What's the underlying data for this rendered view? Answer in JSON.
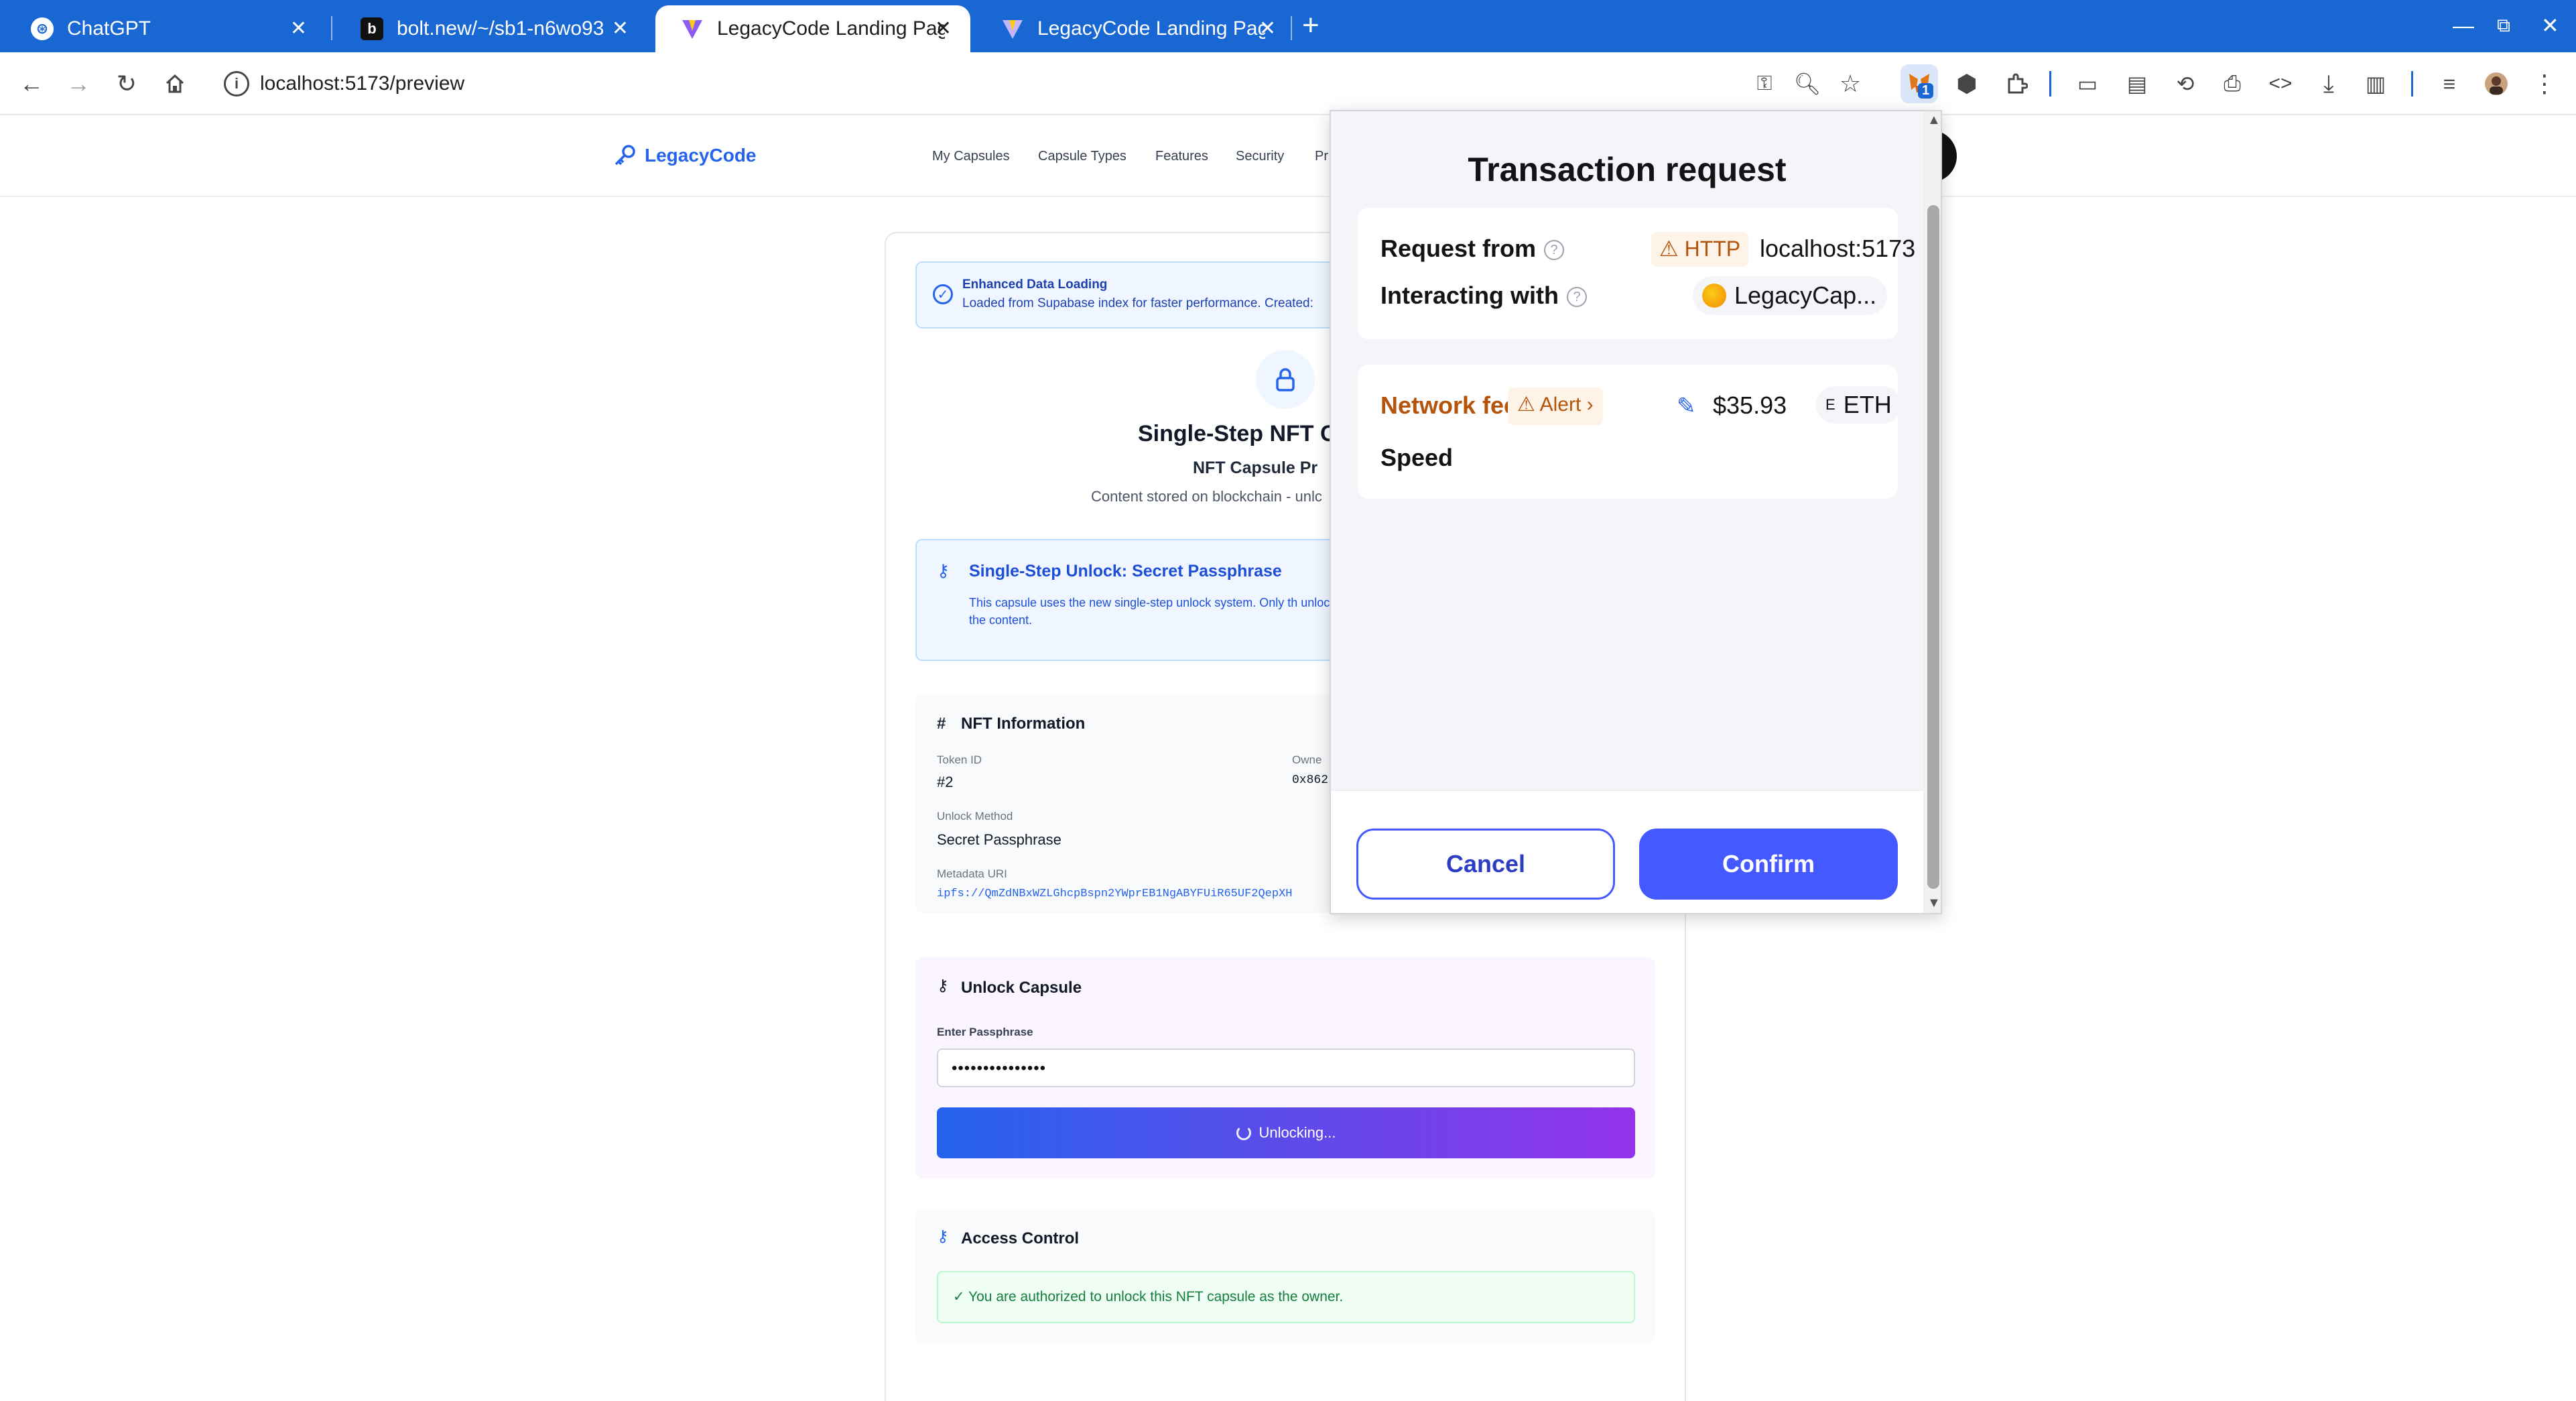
{
  "browser": {
    "tabs": [
      {
        "title": "ChatGPT",
        "icon": "chatgpt-icon"
      },
      {
        "title": "bolt.new/~/sb1-n6wo93",
        "icon": "bolt-icon"
      },
      {
        "title": "LegacyCode Landing Pag",
        "icon": "vite-icon"
      },
      {
        "title": "LegacyCode Landing Pag",
        "icon": "vite-icon"
      }
    ],
    "active_tab": 2,
    "url": "localhost:5173/preview",
    "extension_badge": "1",
    "accent": "#1967d2"
  },
  "site": {
    "logo_text": "LegacyCode",
    "nav": [
      "My Capsules",
      "Capsule Types",
      "Features",
      "Security",
      "Pr"
    ]
  },
  "banner": {
    "title": "Enhanced Data Loading",
    "subtitle": "Loaded from Supabase index for faster performance. Created:"
  },
  "capsule": {
    "title": "Single-Step NFT C",
    "subtitle": "NFT Capsule Pr",
    "note": "Content stored on blockchain - unlc"
  },
  "unlock_info": {
    "title": "Single-Step Unlock: Secret Passphrase",
    "text": "This capsule uses the new single-step unlock system. Only th unlock the content."
  },
  "nft_info": {
    "title": "NFT Information",
    "token_id_label": "Token ID",
    "token_id": "#2",
    "owner_label": "Owne",
    "owner": "0x862",
    "unlock_method_label": "Unlock Method",
    "unlock_method": "Secret Passphrase",
    "metadata_label": "Metadata URI",
    "metadata_uri": "ipfs://QmZdNBxWZLGhcpBspn2YWprEB1NgABYFUiR65UF2QepXH"
  },
  "unlock_capsule": {
    "title": "Unlock Capsule",
    "input_label": "Enter Passphrase",
    "input_value": "•••••••••••••••",
    "button_label": "Unlocking..."
  },
  "access_control": {
    "title": "Access Control",
    "message": "✓ You are authorized to unlock this NFT capsule as the owner."
  },
  "wallet": {
    "title": "Transaction request",
    "request_from_label": "Request from",
    "http_badge": "HTTP",
    "host": "localhost:5173",
    "interacting_label": "Interacting with",
    "dapp_name": "LegacyCap...",
    "network_fee_label": "Network fee",
    "alert_label": "Alert",
    "fee_amount": "$35.93",
    "fee_currency": "ETH",
    "speed_label": "Speed",
    "cancel_label": "Cancel",
    "confirm_label": "Confirm",
    "confirm_color": "#4459ff",
    "warning_color": "#b45309"
  }
}
